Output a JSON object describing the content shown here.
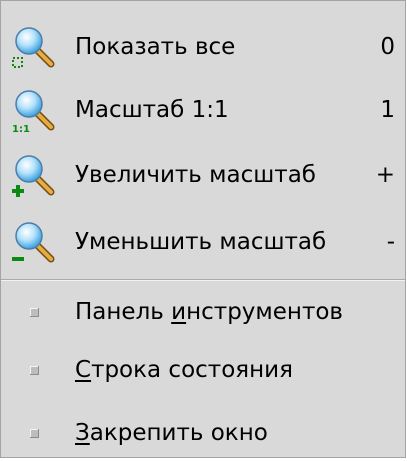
{
  "menu": {
    "zoom_items": [
      {
        "label": "Показать все",
        "shortcut": "0",
        "icon": "zoom-fit-icon"
      },
      {
        "label": "Масштаб 1:1",
        "shortcut": "1",
        "icon": "zoom-original-icon"
      },
      {
        "label": "Увеличить масштаб",
        "shortcut": "+",
        "icon": "zoom-in-icon"
      },
      {
        "label": "Уменьшить масштаб",
        "shortcut": "-",
        "icon": "zoom-out-icon"
      }
    ],
    "toggle_items": [
      {
        "label_pre": "Панель ",
        "label_mnemonic": "и",
        "label_post": "нструментов",
        "checked": false
      },
      {
        "label_pre": "",
        "label_mnemonic": "С",
        "label_post": "трока состояния",
        "checked": false
      },
      {
        "label_pre": "",
        "label_mnemonic": "З",
        "label_post": "акрепить окно",
        "checked": false
      }
    ]
  },
  "colors": {
    "menu_bg": "#d9d9d9",
    "magnifier_glass": "#8fd0f5",
    "magnifier_handle": "#d9a13a",
    "badge_green": "#0b8a12"
  }
}
